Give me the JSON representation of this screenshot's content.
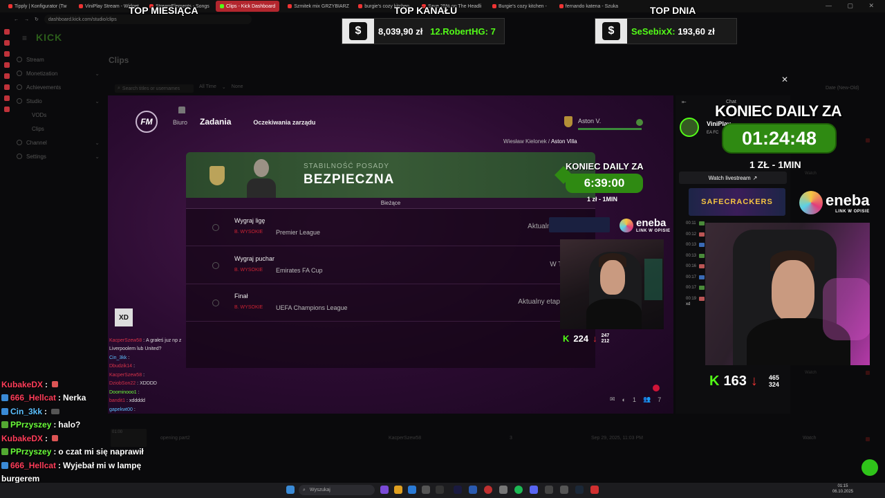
{
  "browser": {
    "tabs": [
      {
        "label": "Tipply | Konfigurator (Tw",
        "active": false
      },
      {
        "label": "ViniPlay Stream - Widget",
        "active": false
      },
      {
        "label": "StreamElements - Songs",
        "active": false
      },
      {
        "label": "Clips - Kick Dashboard",
        "active": true
      },
      {
        "label": "Szmitek mix GRZYBIARZ",
        "active": false
      },
      {
        "label": "burgie's cozy kitchen",
        "active": false
      },
      {
        "label": "Save 25% on The Headli",
        "active": false
      },
      {
        "label": "Burgie's cozy kitchen - ",
        "active": false
      },
      {
        "label": "fernando katena - Szuka",
        "active": false
      }
    ],
    "url": "dashboard.kick.com/studio/clips"
  },
  "dashboard": {
    "logo": "KICK",
    "sidebar": [
      {
        "label": "Stream",
        "sub": false,
        "chevron": false
      },
      {
        "label": "Monetization",
        "sub": false,
        "chevron": true
      },
      {
        "label": "Achievements",
        "sub": false,
        "chevron": false
      },
      {
        "label": "Studio",
        "sub": false,
        "chevron": true
      },
      {
        "label": "VODs",
        "sub": true,
        "chevron": false
      },
      {
        "label": "Clips",
        "sub": true,
        "chevron": false
      },
      {
        "label": "Channel",
        "sub": false,
        "chevron": true
      },
      {
        "label": "Settings",
        "sub": false,
        "chevron": true
      }
    ],
    "page_title": "Clips",
    "search_placeholder": "Search titles or usernames",
    "filter_all_time": "All Time",
    "filter_none": "None",
    "sort_label": "Date (New-Old)",
    "clip_row": {
      "title": "opening part2",
      "author": "KacperSzew58",
      "views": "3",
      "date": "Sep 29, 2025, 11:03 PM",
      "action": "Watch",
      "duration": "01:00"
    },
    "watch_label": "Watch"
  },
  "overlay_top": {
    "month_title": "TOP MIESIĄCA",
    "channel_title": "TOP KANAŁU",
    "channel_text_amount": "8,039,90 zł",
    "channel_text_user": "12.RobertHG: 7",
    "day_title": "TOP DNIA",
    "day_text_user": "SeSebixX:",
    "day_text_amount": "193,60 zł",
    "dollar": "$"
  },
  "game": {
    "logo": "FM",
    "nav_office": "Biuro",
    "nav_tasks": "Zadania",
    "nav_board": "Oczekiwania zarządu",
    "club": "Aston V.",
    "manager": "Wiesław Kielonek",
    "manager_club": "Aston Villa",
    "security_label": "STABILNOŚĆ POSADY",
    "security_value": "BEZPIECZNA",
    "current_label": "Bieżące",
    "tasks": [
      {
        "name": "Wygraj ligę",
        "priority": "B. WYSOKIE",
        "competition": "Premier League",
        "status": "Aktualna poz"
      },
      {
        "name": "Wygraj puchar",
        "priority": "B. WYSOKIE",
        "competition": "Emirates FA Cup",
        "status": "W TO"
      },
      {
        "name": "Finał",
        "priority": "B. WYSOKIE",
        "competition": "UEFA Champions League",
        "status": "Aktualny etap: L"
      }
    ],
    "bottom_count_1": "1",
    "bottom_count_2": "7"
  },
  "daily_small": {
    "title": "KONIEC DAILY ZA",
    "timer": "6:39:00",
    "rate": "1 zł - 1MIN"
  },
  "daily_big": {
    "title": "KONIEC DAILY ZA",
    "timer": "01:24:48",
    "rate": "1 ZŁ - 1MIN"
  },
  "eneba": {
    "name": "eneba",
    "sub": "LINK W OPISIE"
  },
  "cam_small_stats": {
    "viewers": "224",
    "top": "247",
    "bottom": "212"
  },
  "cam_big_stats": {
    "viewers": "163",
    "top": "465",
    "bottom": "324"
  },
  "kick_chat": {
    "title": "Chat",
    "streamer": "ViniPlay",
    "category": "EA FC",
    "watch_livestream": "Watch livestream",
    "banner": "SAFECRACKERS",
    "times": [
      "00:11",
      "00:12",
      "00:13",
      "00:13",
      "00:16",
      "00:17",
      "00:17",
      "00:19"
    ],
    "last_msg": "xd"
  },
  "stream_chat": [
    {
      "user": "KubakeDX",
      "color": "red",
      "badge": "",
      "msg": ""
    },
    {
      "user": "666_Hellcat",
      "color": "red",
      "badge": "blue",
      "msg": "Nerka"
    },
    {
      "user": "Cin_3kk",
      "color": "blue",
      "badge": "blue",
      "msg": ""
    },
    {
      "user": "PPrzyszey",
      "color": "green",
      "badge": "green",
      "msg": "halo?"
    },
    {
      "user": "KubakeDX",
      "color": "red",
      "badge": "",
      "msg": ""
    },
    {
      "user": "PPrzyszey",
      "color": "green",
      "badge": "green",
      "msg": "o czat mi się naprawił"
    },
    {
      "user": "666_Hellcat",
      "color": "red",
      "badge": "blue",
      "msg": "Wyjebał mi w lampę"
    },
    {
      "user": "",
      "color": "",
      "badge": "",
      "msg": "burgerem"
    },
    {
      "user": "PPrzyszey",
      "color": "green",
      "badge": "green",
      "msg": ""
    }
  ],
  "mini_chat": {
    "emote_text": "XD",
    "lines": [
      {
        "user": "KacperSzew58",
        "color": "r",
        "msg": "A grałeś juz np z"
      },
      {
        "user": "",
        "color": "",
        "msg": "Liverpoolem lub United?"
      },
      {
        "user": "Cin_3kk",
        "color": "b",
        "msg": ""
      },
      {
        "user": "Dbudzik14",
        "color": "r",
        "msg": ""
      },
      {
        "user": "KacperSzew58",
        "color": "r",
        "msg": ""
      },
      {
        "user": "DziobSon22",
        "color": "",
        "msg": "XDDDD"
      },
      {
        "user": "Doominooo1",
        "color": "g",
        "msg": ""
      },
      {
        "user": "bandit1",
        "color": "r",
        "msg": "xddddd"
      },
      {
        "user": "gapekwt00",
        "color": "b",
        "msg": ""
      }
    ]
  },
  "taskbar": {
    "search": "Wyszukaj",
    "time": "01:15",
    "date": "06.10.2025"
  }
}
